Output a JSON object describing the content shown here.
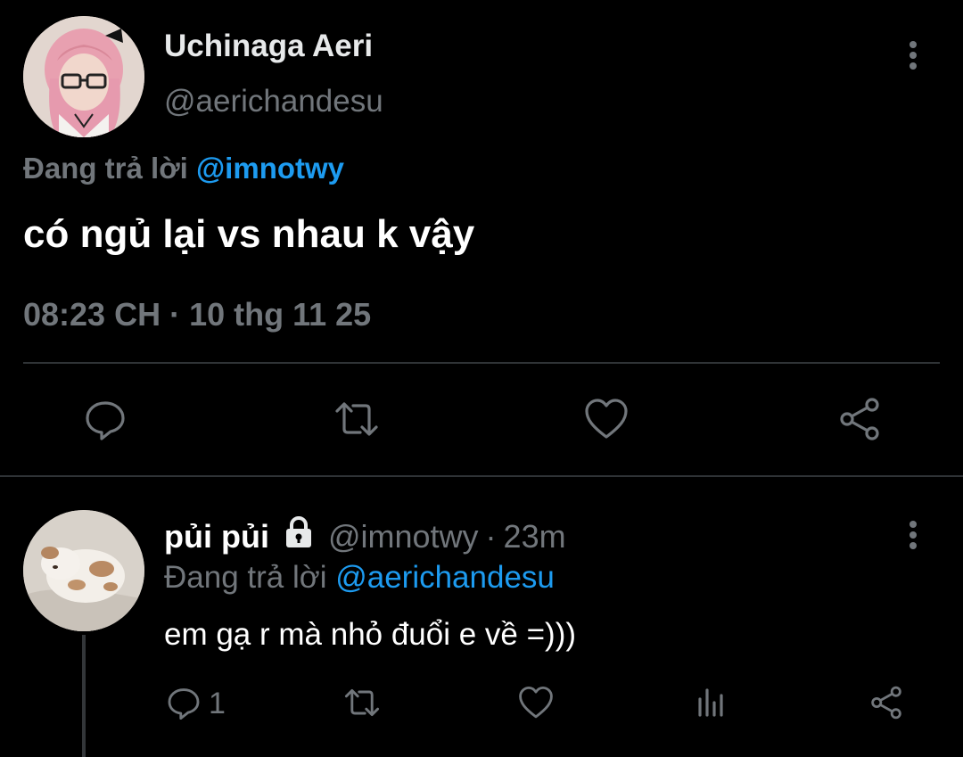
{
  "main_tweet": {
    "display_name": "Uchinaga Aeri",
    "handle": "@aerichandesu",
    "replying_prefix": "Đang trả lời",
    "replying_to": "@imnotwy",
    "text": "có ngủ lại vs nhau k vậy",
    "timestamp": "08:23 CH · 10 thg 11 25",
    "actions": [
      "reply-icon",
      "retweet-icon",
      "like-icon",
      "share-icon"
    ],
    "more_icon": "more-vertical-icon"
  },
  "reply_tweet": {
    "display_name": "pủi pủi",
    "lock_icon": "lock-icon",
    "handle": "@imnotwy",
    "separator": "·",
    "time": "23m",
    "replying_prefix": "Đang trả lời",
    "replying_to": "@aerichandesu",
    "text": "em gạ r mà nhỏ đuổi e về =)))",
    "reply_count": "1",
    "actions": [
      "reply-icon",
      "retweet-icon",
      "like-icon",
      "views-icon",
      "share-icon"
    ],
    "more_icon": "more-vertical-icon"
  },
  "colors": {
    "background": "#000000",
    "text": "#e7e9ea",
    "muted": "#71767b",
    "link": "#1d9bf0",
    "divider": "#2f3336"
  }
}
